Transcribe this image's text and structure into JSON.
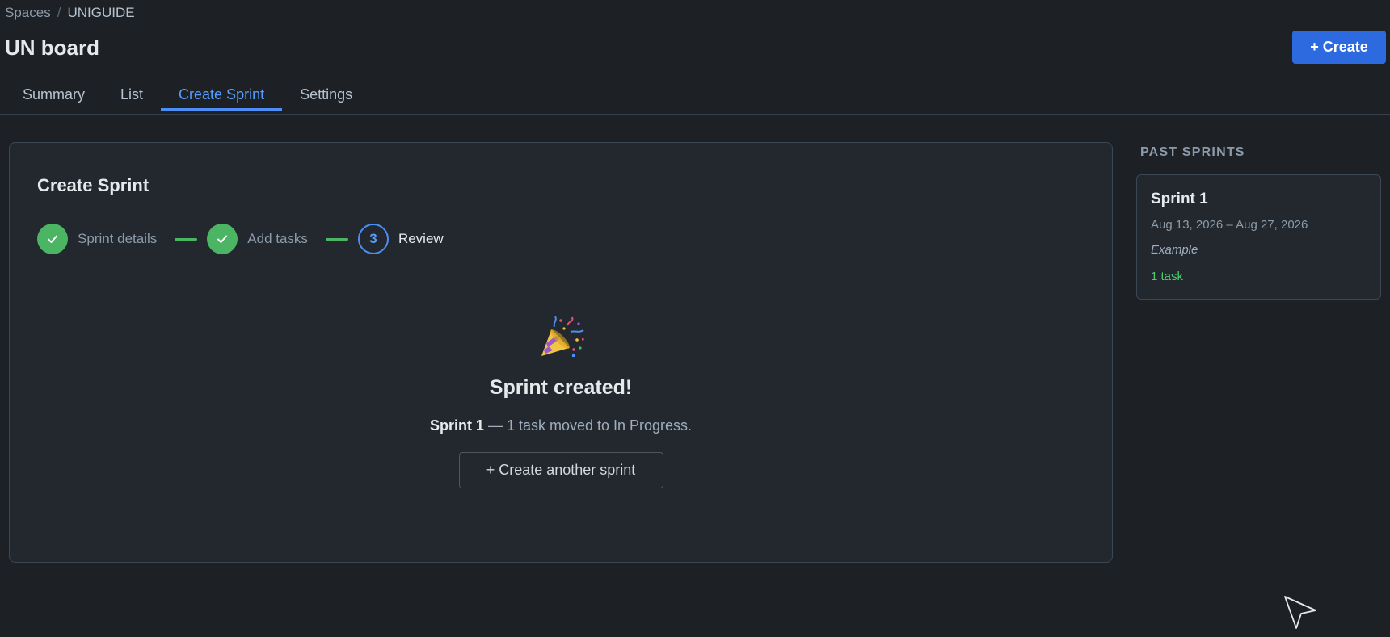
{
  "breadcrumb": {
    "root": "Spaces",
    "separator": "/",
    "current": "UNIGUIDE"
  },
  "header": {
    "title": "UN board",
    "create_label": "+ Create"
  },
  "tabs": [
    {
      "label": "Summary",
      "active": false
    },
    {
      "label": "List",
      "active": false
    },
    {
      "label": "Create Sprint",
      "active": true
    },
    {
      "label": "Settings",
      "active": false
    }
  ],
  "create_sprint": {
    "title": "Create Sprint",
    "steps": [
      {
        "label": "Sprint details",
        "status": "done",
        "icon": "check-icon"
      },
      {
        "label": "Add tasks",
        "status": "done",
        "icon": "check-icon"
      },
      {
        "label": "Review",
        "status": "current",
        "number": "3"
      }
    ],
    "success": {
      "icon": "party-popper-icon",
      "title": "Sprint created!",
      "sprint_name": "Sprint 1",
      "message": " — 1 task moved to In Progress.",
      "another_label": "+ Create another sprint"
    }
  },
  "past_sprints": {
    "heading": "PAST SPRINTS",
    "items": [
      {
        "name": "Sprint 1",
        "dates": "Aug 13, 2026 – Aug 27, 2026",
        "goal": "Example",
        "task_count": "1 task"
      }
    ]
  },
  "colors": {
    "background": "#1d2125",
    "panel": "#22282e",
    "accent": "#2d6ae0",
    "active_tab": "#579dff",
    "success": "#4bb563"
  }
}
